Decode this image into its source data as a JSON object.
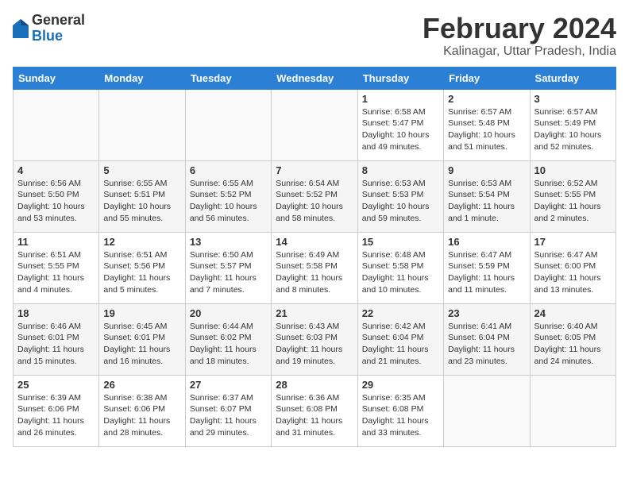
{
  "header": {
    "logo_general": "General",
    "logo_blue": "Blue",
    "month_title": "February 2024",
    "location": "Kalinagar, Uttar Pradesh, India"
  },
  "days_of_week": [
    "Sunday",
    "Monday",
    "Tuesday",
    "Wednesday",
    "Thursday",
    "Friday",
    "Saturday"
  ],
  "weeks": [
    {
      "days": [
        {
          "number": "",
          "info": ""
        },
        {
          "number": "",
          "info": ""
        },
        {
          "number": "",
          "info": ""
        },
        {
          "number": "",
          "info": ""
        },
        {
          "number": "1",
          "info": "Sunrise: 6:58 AM\nSunset: 5:47 PM\nDaylight: 10 hours and 49 minutes."
        },
        {
          "number": "2",
          "info": "Sunrise: 6:57 AM\nSunset: 5:48 PM\nDaylight: 10 hours and 51 minutes."
        },
        {
          "number": "3",
          "info": "Sunrise: 6:57 AM\nSunset: 5:49 PM\nDaylight: 10 hours and 52 minutes."
        }
      ]
    },
    {
      "days": [
        {
          "number": "4",
          "info": "Sunrise: 6:56 AM\nSunset: 5:50 PM\nDaylight: 10 hours and 53 minutes."
        },
        {
          "number": "5",
          "info": "Sunrise: 6:55 AM\nSunset: 5:51 PM\nDaylight: 10 hours and 55 minutes."
        },
        {
          "number": "6",
          "info": "Sunrise: 6:55 AM\nSunset: 5:52 PM\nDaylight: 10 hours and 56 minutes."
        },
        {
          "number": "7",
          "info": "Sunrise: 6:54 AM\nSunset: 5:52 PM\nDaylight: 10 hours and 58 minutes."
        },
        {
          "number": "8",
          "info": "Sunrise: 6:53 AM\nSunset: 5:53 PM\nDaylight: 10 hours and 59 minutes."
        },
        {
          "number": "9",
          "info": "Sunrise: 6:53 AM\nSunset: 5:54 PM\nDaylight: 11 hours and 1 minute."
        },
        {
          "number": "10",
          "info": "Sunrise: 6:52 AM\nSunset: 5:55 PM\nDaylight: 11 hours and 2 minutes."
        }
      ]
    },
    {
      "days": [
        {
          "number": "11",
          "info": "Sunrise: 6:51 AM\nSunset: 5:55 PM\nDaylight: 11 hours and 4 minutes."
        },
        {
          "number": "12",
          "info": "Sunrise: 6:51 AM\nSunset: 5:56 PM\nDaylight: 11 hours and 5 minutes."
        },
        {
          "number": "13",
          "info": "Sunrise: 6:50 AM\nSunset: 5:57 PM\nDaylight: 11 hours and 7 minutes."
        },
        {
          "number": "14",
          "info": "Sunrise: 6:49 AM\nSunset: 5:58 PM\nDaylight: 11 hours and 8 minutes."
        },
        {
          "number": "15",
          "info": "Sunrise: 6:48 AM\nSunset: 5:58 PM\nDaylight: 11 hours and 10 minutes."
        },
        {
          "number": "16",
          "info": "Sunrise: 6:47 AM\nSunset: 5:59 PM\nDaylight: 11 hours and 11 minutes."
        },
        {
          "number": "17",
          "info": "Sunrise: 6:47 AM\nSunset: 6:00 PM\nDaylight: 11 hours and 13 minutes."
        }
      ]
    },
    {
      "days": [
        {
          "number": "18",
          "info": "Sunrise: 6:46 AM\nSunset: 6:01 PM\nDaylight: 11 hours and 15 minutes."
        },
        {
          "number": "19",
          "info": "Sunrise: 6:45 AM\nSunset: 6:01 PM\nDaylight: 11 hours and 16 minutes."
        },
        {
          "number": "20",
          "info": "Sunrise: 6:44 AM\nSunset: 6:02 PM\nDaylight: 11 hours and 18 minutes."
        },
        {
          "number": "21",
          "info": "Sunrise: 6:43 AM\nSunset: 6:03 PM\nDaylight: 11 hours and 19 minutes."
        },
        {
          "number": "22",
          "info": "Sunrise: 6:42 AM\nSunset: 6:04 PM\nDaylight: 11 hours and 21 minutes."
        },
        {
          "number": "23",
          "info": "Sunrise: 6:41 AM\nSunset: 6:04 PM\nDaylight: 11 hours and 23 minutes."
        },
        {
          "number": "24",
          "info": "Sunrise: 6:40 AM\nSunset: 6:05 PM\nDaylight: 11 hours and 24 minutes."
        }
      ]
    },
    {
      "days": [
        {
          "number": "25",
          "info": "Sunrise: 6:39 AM\nSunset: 6:06 PM\nDaylight: 11 hours and 26 minutes."
        },
        {
          "number": "26",
          "info": "Sunrise: 6:38 AM\nSunset: 6:06 PM\nDaylight: 11 hours and 28 minutes."
        },
        {
          "number": "27",
          "info": "Sunrise: 6:37 AM\nSunset: 6:07 PM\nDaylight: 11 hours and 29 minutes."
        },
        {
          "number": "28",
          "info": "Sunrise: 6:36 AM\nSunset: 6:08 PM\nDaylight: 11 hours and 31 minutes."
        },
        {
          "number": "29",
          "info": "Sunrise: 6:35 AM\nSunset: 6:08 PM\nDaylight: 11 hours and 33 minutes."
        },
        {
          "number": "",
          "info": ""
        },
        {
          "number": "",
          "info": ""
        }
      ]
    }
  ]
}
